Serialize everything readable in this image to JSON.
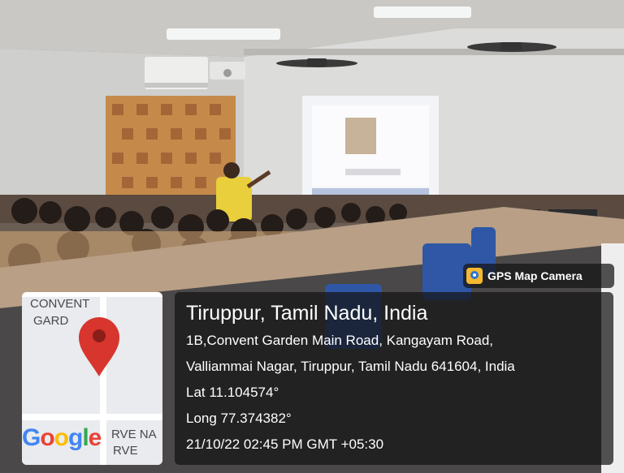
{
  "gps_badge": {
    "app_name": "GPS Map Camera",
    "icon": "gps-map-camera-app-icon"
  },
  "map": {
    "labels": [
      "CONVENT",
      "GARD",
      "RVE NA",
      "RVE"
    ],
    "logo_text": "Google",
    "pin_icon": "map-pin-icon",
    "colors": {
      "pin": "#d7352d",
      "blue": "#4285f4",
      "red": "#ea4335",
      "yellow": "#fbbc05",
      "green": "#34a853"
    }
  },
  "location": {
    "title": "Tiruppur, Tamil Nadu, India",
    "address_line1": "1B,Convent Garden Main Road, Kangayam Road,",
    "address_line2": "Valliammai Nagar, Tiruppur, Tamil Nadu 641604, India",
    "latitude": "Lat 11.104574°",
    "longitude": "Long 77.374382°",
    "timestamp": "21/10/22 02:45 PM GMT +05:30"
  }
}
